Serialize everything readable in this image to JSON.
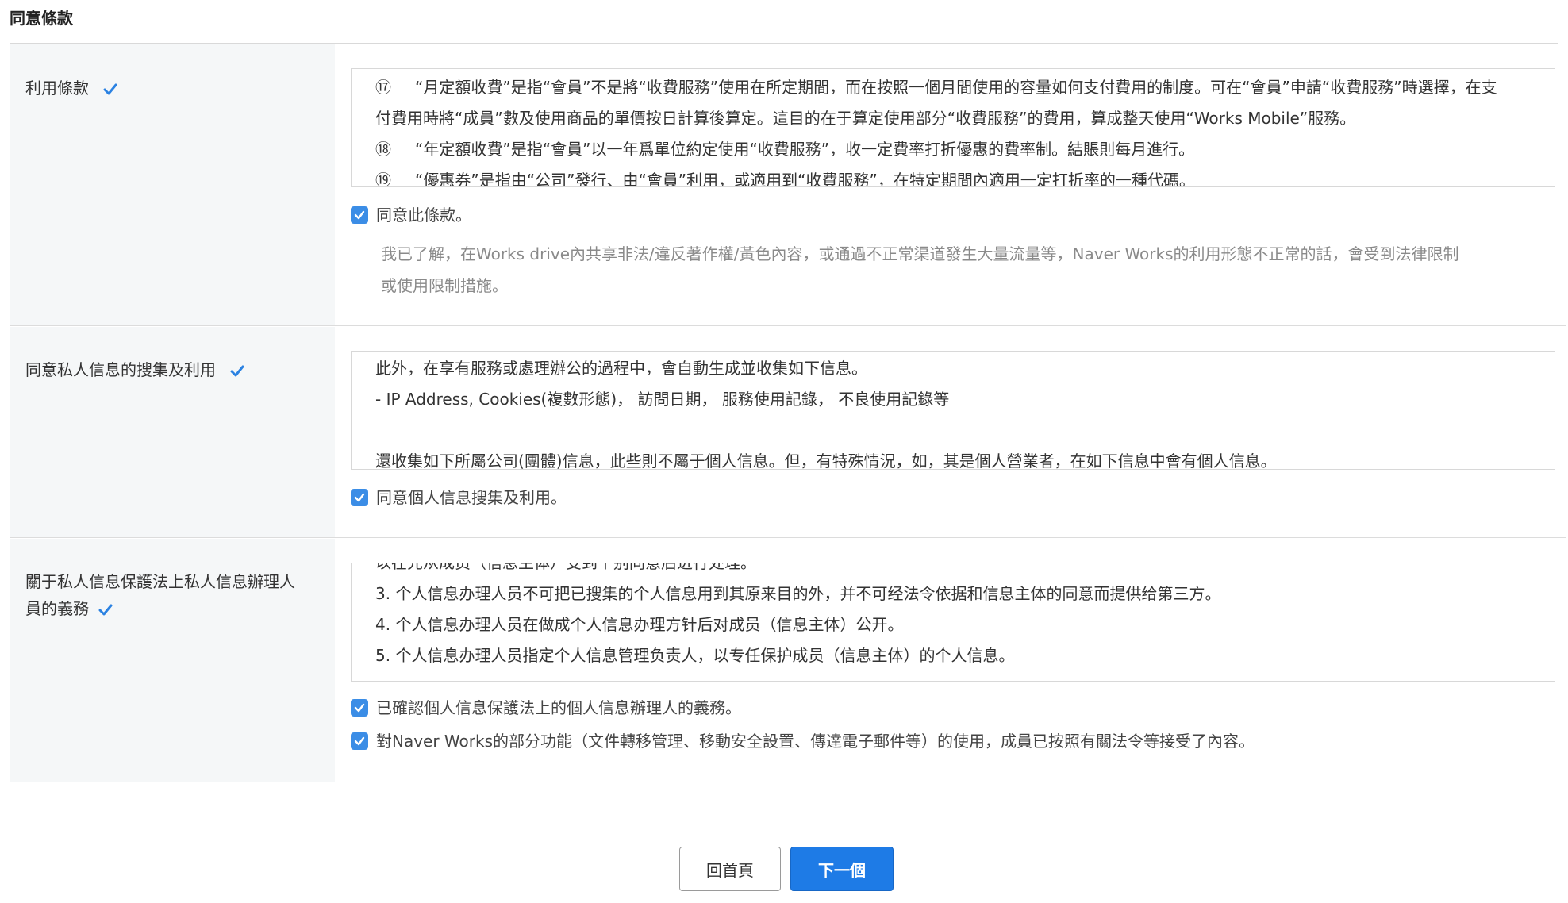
{
  "page": {
    "title": "同意條款"
  },
  "sections": {
    "terms": {
      "label": "利用條款",
      "content": [
        {
          "num": "⑰",
          "text": "“月定額收費”是指“會員”不是將“收費服務”使用在所定期間，而在按照一個月間使用的容量如何支付費用的制度。可在“會員”申請“收費服務”時選擇，在支"
        },
        {
          "num": "",
          "text": "付費用時將“成員”數及使用商品的單價按日計算後算定。這目的在于算定使用部分“收費服務”的費用，算成整天使用“Works Mobile”服務。"
        },
        {
          "num": "⑱",
          "text": "“年定額收費”是指“會員”以一年爲單位約定使用“收費服務”，收一定費率打折優惠的費率制。結賬則每月進行。"
        },
        {
          "num": "⑲",
          "text": "“優惠券”是指由“公司”發行、由“會員”利用，或適用到“收費服務”，在特定期間內適用一定打折率的一種代碼。"
        }
      ],
      "checkbox_label": "同意此條款。",
      "note_line1": "我已了解，在Works drive內共享非法/違反著作權/黃色內容，或通過不正常渠道發生大量流量等，Naver Works的利用形態不正常的話，會受到法律限制",
      "note_line2": "或使用限制措施。"
    },
    "privacy": {
      "label": "同意私人信息的搜集及利用",
      "content": [
        "此外，在享有服務或處理辦公的過程中，會自動生成並收集如下信息。",
        "- IP Address, Cookies(複數形態)， 訪問日期， 服務使用記錄， 不良使用記錄等",
        "",
        "還收集如下所屬公司(團體)信息，此些則不屬于個人信息。但，有特殊情況，如，其是個人營業者，在如下信息中會有個人信息。"
      ],
      "checkbox_label": "同意個人信息搜集及利用。"
    },
    "duty": {
      "label_line1": "關于私人信息保護法上私人信息辦理人",
      "label_line2": "員的義務",
      "content": [
        "以在先从成员（信息主体）受到个别同意后进行处理。",
        "3. 个人信息办理人员不可把已搜集的个人信息用到其原来目的外，并不可经法令依据和信息主体的同意而提供给第三方。",
        "4. 个人信息办理人员在做成个人信息办理方针后对成员（信息主体）公开。",
        "5. 个人信息办理人员指定个人信息管理负责人，以专任保护成员（信息主体）的个人信息。"
      ],
      "checkbox1_label": "已確認個人信息保護法上的個人信息辦理人的義務。",
      "checkbox2_label": "對Naver Works的部分功能（文件轉移管理、移動安全設置、傳達電子郵件等）的使用，成員已按照有關法令等接受了內容。"
    }
  },
  "buttons": {
    "home": "回首頁",
    "next": "下一個"
  },
  "colors": {
    "accent": "#1e7be6",
    "checkbox": "#3b8de6",
    "label_bg": "#f5f7f8"
  }
}
